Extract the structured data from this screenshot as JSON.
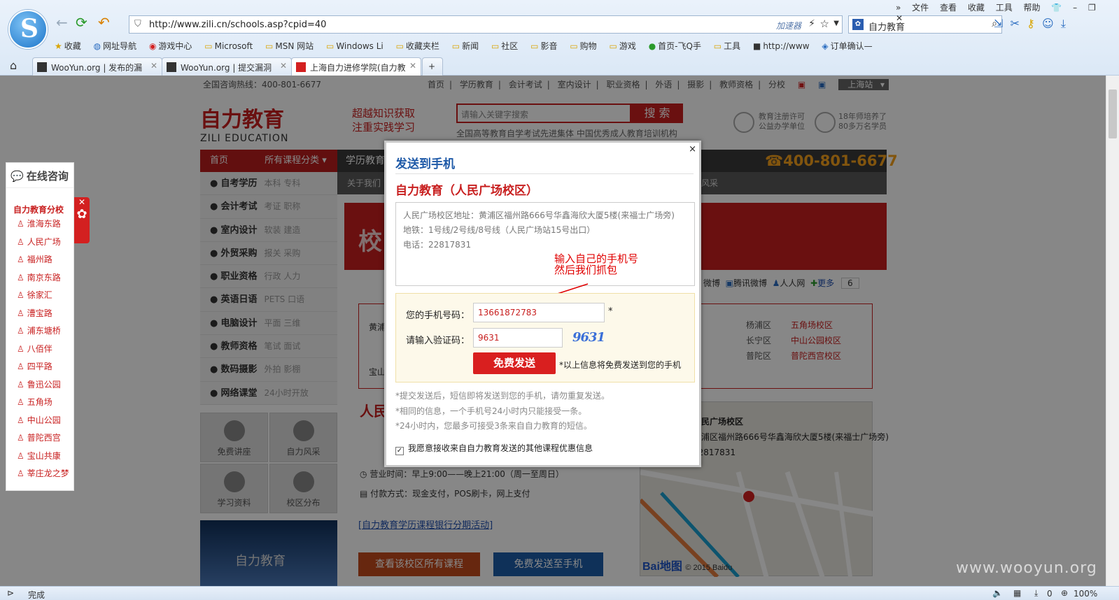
{
  "browser": {
    "logo_char": "S",
    "url": "http://www.zili.cn/schools.asp?cpid=40",
    "accelerator": "加速器",
    "search_engine_value": "自力教育",
    "menu": [
      "文件",
      "查看",
      "收藏",
      "工具",
      "帮助"
    ],
    "bookmarks": [
      "收藏",
      "网址导航",
      "游戏中心",
      "Microsoft",
      "MSN 网站",
      "Windows Li",
      "收藏夹栏",
      "新闻",
      "社区",
      "影音",
      "购物",
      "游戏",
      "首页-飞Q手",
      "工具",
      "http://www",
      "订单确认—"
    ],
    "tabs": [
      "WooYun.org | 发布的漏",
      "WooYun.org | 提交漏洞",
      "上海自力进修学院(自力教"
    ],
    "status_text": "完成",
    "status_zoom": "100%",
    "status_count": "0"
  },
  "site": {
    "hotline": "全国咨询热线：400-801-6677",
    "topnav": [
      "首页",
      "学历教育",
      "会计考试",
      "室内设计",
      "职业资格",
      "外语",
      "摄影",
      "教师资格",
      "分校"
    ],
    "station": "上海站",
    "logo_cn": "自力教育",
    "logo_en": "ZILI EDUCATION",
    "slogan1": "超越知识获取",
    "slogan2": "注重实践学习",
    "search_placeholder": "请输入关键字搜索",
    "search_btn": "搜 索",
    "sub_slogan": "全国高等教育自学考试先进集体    中国优秀成人教育培训机构",
    "badge1a": "教育注册许可",
    "badge1b": "公益办学单位",
    "badge2a": "18年师培养了",
    "badge2b": "80多万名学员",
    "nav_home": "首页",
    "nav_allcats": "所有课程分类 ▾",
    "nav_dark_first": "学历教育",
    "nav_sub_first": "关于我们",
    "nav_sub_last": "风采",
    "phone": "400-801-6677",
    "categories": [
      {
        "name": "自考学历",
        "tags": "本科  专科"
      },
      {
        "name": "会计考试",
        "tags": "考证  职称"
      },
      {
        "name": "室内设计",
        "tags": "软装  建造"
      },
      {
        "name": "外贸采购",
        "tags": "报关  采购"
      },
      {
        "name": "职业资格",
        "tags": "行政  人力"
      },
      {
        "name": "英语日语",
        "tags": "PETS  口语"
      },
      {
        "name": "电脑设计",
        "tags": "平面  三维"
      },
      {
        "name": "教师资格",
        "tags": "笔试  面试"
      },
      {
        "name": "数码摄影",
        "tags": "外拍  影棚"
      },
      {
        "name": "网络课堂",
        "tags": "24小时开放"
      }
    ],
    "banner_text": "校",
    "tiles": [
      "免费讲座",
      "自力风采",
      "学习资料",
      "校区分布"
    ],
    "video_text": "自力教育",
    "share": [
      "微博",
      "腾讯微博",
      "人人网",
      "更多"
    ],
    "share_count": "6",
    "area_left1": "黄浦",
    "area_left2": "宝山",
    "area_rows": [
      {
        "district": "杨浦区",
        "school": "五角场校区"
      },
      {
        "district": "长宁区",
        "school": "中山公园校区"
      },
      {
        "district": "普陀区",
        "school": "普陀西宫校区"
      }
    ],
    "red_title": "人民",
    "hours": "营业时间：早上9:00——晚上21:00（周一至周日）",
    "payment": "付款方式：现金支付，POS刷卡，网上支付",
    "link_installment": "[自力教育学历课程银行分期活动]",
    "btn_all_courses": "查看该校区所有课程",
    "btn_send_phone": "免费发送至手机",
    "map_school": "人民广场校区",
    "map_address": "黄浦区福州路666号华鑫海欣大厦5楼(来福士广场旁)",
    "map_phone": "22817831",
    "map_brand": "Bai地图",
    "map_copyright": "© 2015 Baidu"
  },
  "consult": {
    "title": "在线咨询",
    "subtitle": "自力教育分校",
    "items": [
      "淮海东路",
      "人民广场",
      "福州路",
      "南京东路",
      "徐家汇",
      "漕宝路",
      "浦东塘桥",
      "八佰伴",
      "四平路",
      "鲁迅公园",
      "五角场",
      "中山公园",
      "普陀西宫",
      "宝山共康",
      "莘庄龙之梦"
    ]
  },
  "modal": {
    "close": "×",
    "title": "发送到手机",
    "school": "自力教育（人民广场校区）",
    "info_lines": [
      "人民广场校区地址：黄浦区福州路666号华鑫海欣大厦5楼(来福士广场旁)",
      "地铁：1号线/2号线/8号线（人民广场站15号出口）",
      "电话：22817831"
    ],
    "annotation_line1": "输入自己的手机号",
    "annotation_line2": "然后我们抓包",
    "phone_label": "您的手机号码：",
    "phone_value": "13661872783",
    "phone_required": "*",
    "code_label": "请输入验证码：",
    "code_value": "9631",
    "captcha": "9631",
    "send_btn": "免费发送",
    "send_note": "*以上信息将免费发送到您的手机",
    "notes": [
      "*提交发送后，短信即将发送到您的手机，请勿重复发送。",
      "*相同的信息，一个手机号24小时内只能接受一条。",
      "*24小时内，您最多可接受3条来自自力教育的短信。"
    ],
    "agree_text": "我愿意接收来自自力教育发送的其他课程优惠信息",
    "agree_checked": "✓"
  },
  "watermark": "www.wooyun.org"
}
